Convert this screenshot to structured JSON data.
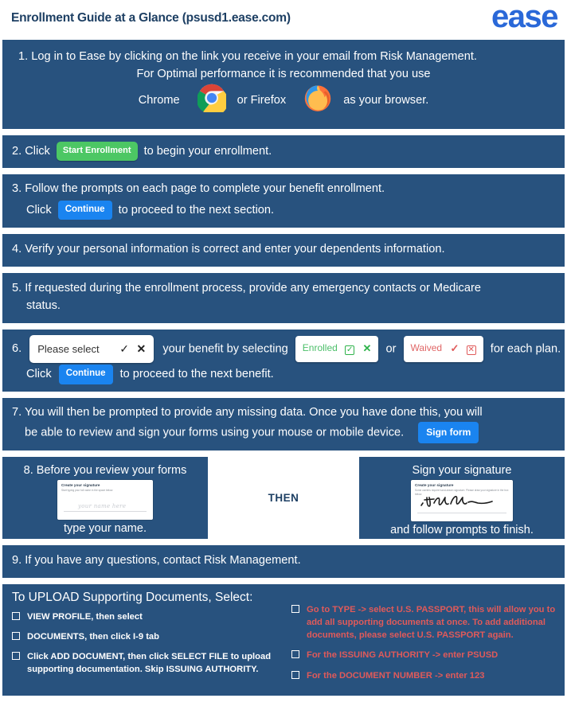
{
  "header": {
    "title": "Enrollment Guide at a Glance (psusd1.ease.com)",
    "logo": "ease",
    "logo_color": "#2a68d8",
    "title_color": "#1d3f63"
  },
  "theme": {
    "block_bg": "#28527e",
    "green_button": "#4cc764",
    "blue_button": "#1a84f0",
    "enrolled_green": "#4cbf6a",
    "waived_red": "#e06666"
  },
  "steps": {
    "s1": {
      "number": "1.",
      "line1": "Log in to Ease by clicking on the link you receive in your email from Risk Management.",
      "line2": "For Optimal performance it is recommended that you use",
      "line3a": "Chrome",
      "line3b": "or Firefox",
      "line3c": "as your browser.",
      "chrome_icon": "chrome-icon",
      "firefox_icon": "firefox-icon"
    },
    "s2": {
      "number": "2.",
      "pre": "Click",
      "button": "Start Enrollment",
      "post": "to begin your enrollment."
    },
    "s3": {
      "number": "3.",
      "line1": "Follow the prompts on each page to complete your benefit enrollment.",
      "line2_pre": "Click",
      "button": "Continue",
      "line2_post": "to proceed to the next section."
    },
    "s4": {
      "number": "4.",
      "text": "Verify your personal information is correct and enter your dependents information."
    },
    "s5": {
      "number": "5.",
      "line1": "If requested during the enrollment process, provide any emergency contacts or Medicare",
      "line2": "status."
    },
    "s6": {
      "number": "6.",
      "select_value": "Please select",
      "select_check": "✓",
      "select_x": "✕",
      "mid": "your benefit by selecting",
      "enrolled_label": "Enrolled",
      "enrolled_box": "✓",
      "enrolled_x": "✕",
      "or": "or",
      "waived_label": "Waived",
      "waived_check": "✓",
      "waived_box": "✕",
      "tail": "for each plan.",
      "line2_pre": "Click",
      "button": "Continue",
      "line2_post": "to proceed to the next benefit."
    },
    "s7": {
      "number": "7.",
      "line1": "You will then be prompted to provide any missing data. Once you have done this, you will",
      "line2": "be able to review and sign your forms using your mouse or mobile device.",
      "button": "Sign form"
    },
    "s8": {
      "number": "8.",
      "left_header": "8. Before you review your forms",
      "left_footer": "type your name.",
      "middle": "THEN",
      "right_header": "Sign your signature",
      "right_footer": "and follow prompts to finish.",
      "card_left": {
        "title": "Create your signature",
        "subtitle": "Start typing your full name in the space below.",
        "placeholder": "your name here"
      },
      "card_right": {
        "title": "Create your signature",
        "subtitle": "Some carriers require hand-drawn signature. Please draw your signature in the box below."
      }
    },
    "s9": {
      "number": "9.",
      "text": "If you have any questions, contact Risk Management."
    }
  },
  "upload": {
    "title": "To UPLOAD Supporting Documents, Select:",
    "left_items": [
      {
        "strong": "VIEW PROFILE",
        "rest": ", then select"
      },
      {
        "strong": "DOCUMENTS",
        "rest": ", then click I-9 tab"
      },
      {
        "strong": "Click ADD DOCUMENT",
        "rest": ", then click SELECT FILE to upload supporting documentation. Skip ISSUING AUTHORITY."
      }
    ],
    "right_items": [
      {
        "text": "Go to TYPE -> select U.S. PASSPORT, this will allow you to add all supporting documents at once. To add additional documents, please select U.S. PASSPORT again."
      },
      {
        "text": "For the ISSUING AUTHORITY -> enter PSUSD"
      },
      {
        "text": "For the DOCUMENT NUMBER -> enter 123"
      }
    ]
  }
}
